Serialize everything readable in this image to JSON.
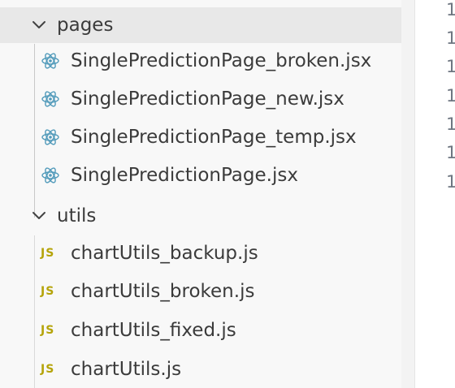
{
  "explorer": {
    "folders": [
      {
        "name": "pages",
        "expanded": true,
        "icon": "chevron-down-icon",
        "files": [
          {
            "name": "SinglePredictionPage_broken.jsx",
            "icon": "react-icon"
          },
          {
            "name": "SinglePredictionPage_new.jsx",
            "icon": "react-icon"
          },
          {
            "name": "SinglePredictionPage_temp.jsx",
            "icon": "react-icon"
          },
          {
            "name": "SinglePredictionPage.jsx",
            "icon": "react-icon"
          }
        ]
      },
      {
        "name": "utils",
        "expanded": true,
        "icon": "chevron-down-icon",
        "files": [
          {
            "name": "chartUtils_backup.js",
            "icon": "js-icon",
            "badge": "JS"
          },
          {
            "name": "chartUtils_broken.js",
            "icon": "js-icon",
            "badge": "JS"
          },
          {
            "name": "chartUtils_fixed.js",
            "icon": "js-icon",
            "badge": "JS"
          },
          {
            "name": "chartUtils.js",
            "icon": "js-icon",
            "badge": "JS"
          }
        ]
      }
    ]
  },
  "editor": {
    "line_numbers": [
      "1",
      "1",
      "1",
      "1",
      "1",
      "1",
      "1"
    ]
  },
  "colors": {
    "react_icon": "#519aba",
    "js_icon": "#b5a40a",
    "hover_row": "#e8e8e8",
    "sidebar_bg": "#f8f8f8"
  }
}
